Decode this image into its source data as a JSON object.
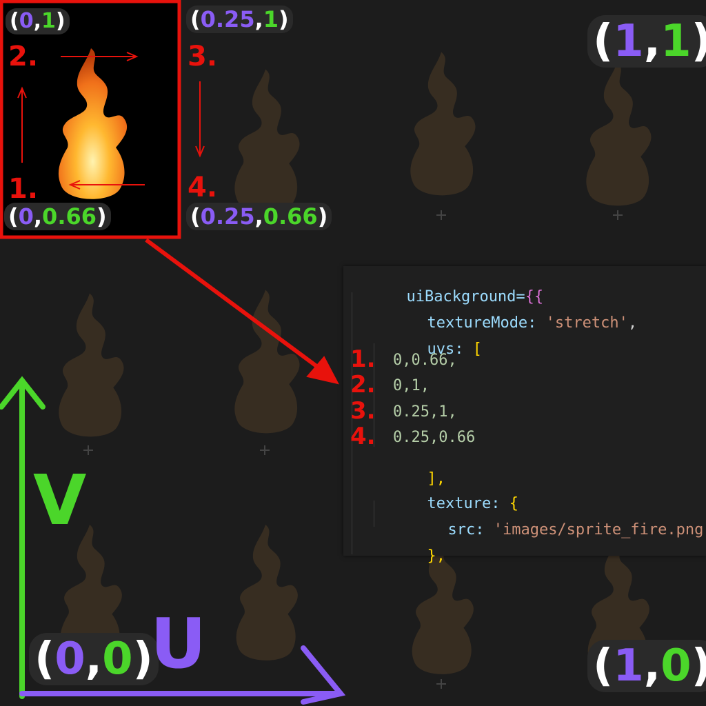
{
  "corners": {
    "top_left": {
      "u": "0",
      "v": "1"
    },
    "top_mid": {
      "u": "0.25",
      "v": "1"
    },
    "bot_left": {
      "u": "0",
      "v": "0.66"
    },
    "bot_mid": {
      "u": "0.25",
      "v": "0.66"
    },
    "top_right": {
      "u": "1",
      "v": "1"
    },
    "origin": {
      "u": "0",
      "v": "0"
    },
    "bot_right": {
      "u": "1",
      "v": "0"
    }
  },
  "steps": [
    "1.",
    "2.",
    "3.",
    "4."
  ],
  "axes": {
    "u_label": "U",
    "v_label": "V"
  },
  "code": {
    "line1_a": "uiBackground=",
    "line1_b": "{{",
    "line2_key": "textureMode: ",
    "line2_val": "'stretch'",
    "line2_end": ",",
    "line3_key": "uvs: ",
    "line3_bracket": "[",
    "uv1": "0,0.66,",
    "uv2": "0,1,",
    "uv3": "0.25,1,",
    "uv4": "0.25,0.66",
    "line8": "],",
    "line9_key": "texture: ",
    "line9_brace": "{",
    "line10_key": "src: ",
    "line10_val": "'images/sprite_fire.png'",
    "line11": "},"
  },
  "colors": {
    "u_axis": "#8a5cf5",
    "v_axis": "#4bd62a",
    "highlight": "#e8120c",
    "code_key": "#9cdcfe",
    "code_string": "#ce9178",
    "code_number": "#b5cea8",
    "code_bracket": "#ffd700"
  }
}
